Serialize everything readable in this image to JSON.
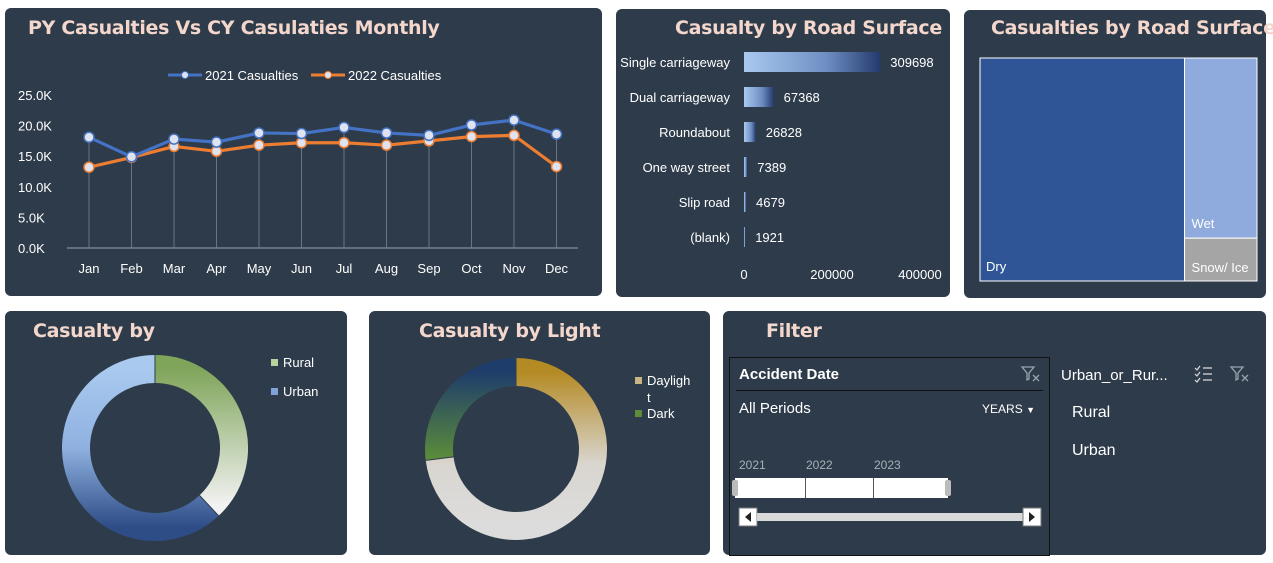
{
  "monthly": {
    "title": "PY Casualties Vs CY Casulaties Monthly",
    "legend": [
      "2021 Casualties",
      "2022 Casualties"
    ],
    "y_ticks": [
      "25.0K",
      "20.0K",
      "15.0K",
      "10.0K",
      "5.0K",
      "0.0K"
    ],
    "colors": {
      "s2021": "#4472c4",
      "s2022": "#ed7d31"
    }
  },
  "road_type": {
    "title": "Casualty by Road Surface",
    "x_ticks": [
      "0",
      "200000",
      "400000"
    ]
  },
  "treemap": {
    "title": "Casualties by Road Surface",
    "labels": [
      "Dry",
      "Wet",
      "Snow/ Ice"
    ]
  },
  "area_donut": {
    "title": "Casualty by",
    "legend": [
      "Rural",
      "Urban"
    ]
  },
  "light_donut": {
    "title": "Casualty by Light",
    "legend": [
      "Daylight",
      "Dark"
    ]
  },
  "filter": {
    "title": "Filter",
    "date_slicer": {
      "header": "Accident Date",
      "period": "All Periods",
      "level": "YEARS",
      "years": [
        "2021",
        "2022",
        "2023"
      ]
    },
    "area_slicer": {
      "header": "Urban_or_Rur...",
      "items": [
        "Rural",
        "Urban"
      ]
    }
  },
  "chart_data": [
    {
      "type": "line",
      "title": "PY Casualties Vs CY Casulaties Monthly",
      "categories": [
        "Jan",
        "Feb",
        "Mar",
        "Apr",
        "May",
        "Jun",
        "Jul",
        "Aug",
        "Sep",
        "Oct",
        "Nov",
        "Dec"
      ],
      "series": [
        {
          "name": "2021 Casualties",
          "values": [
            18100,
            14900,
            17800,
            17300,
            18800,
            18700,
            19700,
            18800,
            18400,
            20100,
            20900,
            18600
          ]
        },
        {
          "name": "2022 Casualties",
          "values": [
            13200,
            14800,
            16600,
            15800,
            16800,
            17200,
            17200,
            16800,
            17500,
            18200,
            18400,
            13300
          ]
        }
      ],
      "ylim": [
        0,
        25000
      ],
      "grid": false,
      "legend": "top"
    },
    {
      "type": "bar",
      "title": "Casualty by Road Surface",
      "categories": [
        "Single carriageway",
        "Dual carriageway",
        "Roundabout",
        "One way street",
        "Slip road",
        "(blank)"
      ],
      "values": [
        309698,
        67368,
        26828,
        7389,
        4679,
        1921
      ],
      "xlim": [
        0,
        400000
      ],
      "orientation": "horizontal"
    },
    {
      "type": "area",
      "title": "Casualties by Road Surface",
      "categories": [
        "Dry",
        "Wet",
        "Snow/ Ice"
      ],
      "values": [
        279445,
        80000,
        19000
      ]
    },
    {
      "type": "pie",
      "title": "Casualty by",
      "categories": [
        "Rural",
        "Urban"
      ],
      "values": [
        38,
        62
      ],
      "donut": true
    },
    {
      "type": "pie",
      "title": "Casualty by Light",
      "categories": [
        "Daylight",
        "Dark"
      ],
      "values": [
        73,
        27
      ],
      "donut": true
    }
  ]
}
